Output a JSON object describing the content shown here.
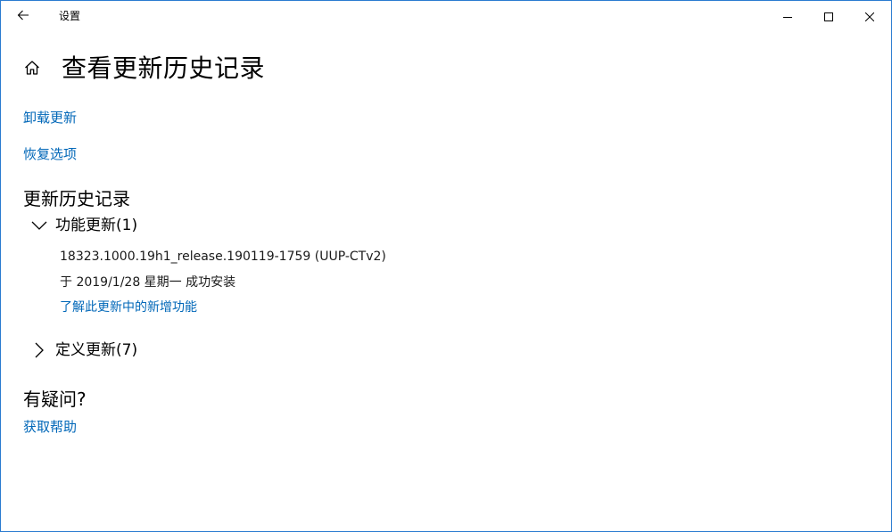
{
  "window": {
    "title": "设置",
    "controls": {
      "minimize": "minimize-icon",
      "maximize": "maximize-icon",
      "close": "close-icon"
    }
  },
  "header": {
    "title": "查看更新历史记录"
  },
  "links": {
    "uninstall": "卸载更新",
    "recovery": "恢复选项"
  },
  "history": {
    "heading": "更新历史记录",
    "groups": [
      {
        "label": "功能更新(1)",
        "expanded": true,
        "items": [
          {
            "name": "18323.1000.19h1_release.190119-1759 (UUP-CTv2)",
            "status": "于 2019/1/28 星期一 成功安装",
            "link": "了解此更新中的新增功能"
          }
        ]
      },
      {
        "label": "定义更新(7)",
        "expanded": false
      }
    ]
  },
  "questions": {
    "heading": "有疑问?",
    "help_link": "获取帮助"
  },
  "colors": {
    "accent": "#0067b8",
    "window_border": "#2b7bd0",
    "text": "#000000",
    "background": "#ffffff"
  }
}
